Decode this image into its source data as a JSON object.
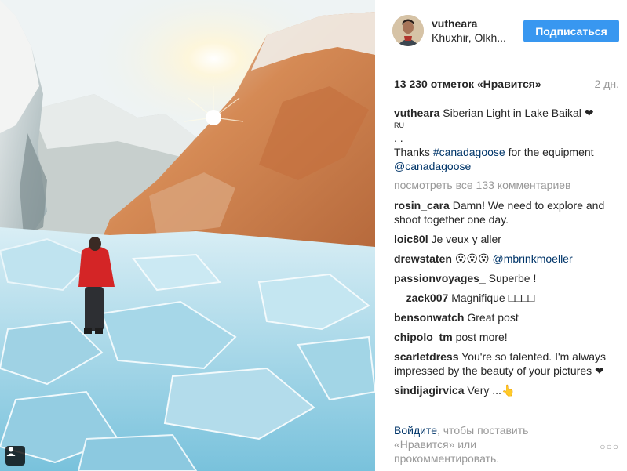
{
  "post": {
    "author": "vutheara",
    "location": "Khuxhir, Olkh...",
    "follow_label": "Подписаться",
    "likes": "13 230 отметок «Нравится»",
    "time": "2 дн."
  },
  "caption": {
    "user": "vutheara",
    "text": "Siberian Light in Lake Baikal",
    "heart": "❤",
    "lang": "RU",
    "dots": ". .",
    "thanks_prefix": "Thanks ",
    "hashtag": "#canadagoose",
    "thanks_suffix": " for the equipment ",
    "mention": "@canadagoose"
  },
  "load_more": "посмотреть все 133 комментариев",
  "comments": [
    {
      "user": "rosin_cara",
      "text": "Damn! We need to explore and shoot together one day."
    },
    {
      "user": "loic80l",
      "text": "Je veux y aller"
    },
    {
      "user": "drewstaten",
      "text": "😮😮😮 ",
      "mention": "@mbrinkmoeller"
    },
    {
      "user": "passionvoyages_",
      "text": "Superbe !"
    },
    {
      "user": "__zack007",
      "text": "Magnifique □□□□"
    },
    {
      "user": "bensonwatch",
      "text": "Great post"
    },
    {
      "user": "chipolo_tm",
      "text": "post more!"
    },
    {
      "user": "scarletdress",
      "text": "You're so talented. I'm always impressed by the beauty of your pictures ❤"
    },
    {
      "user": "sindijagirvica",
      "text": "Very ...👆"
    }
  ],
  "footer": {
    "login_link": "Войдите",
    "login_text": ", чтобы поставить «Нравится» или прокомментировать.",
    "more": "○○○"
  },
  "icons": {
    "user_tag": "person-icon",
    "more": "more-options-icon"
  },
  "colors": {
    "accent": "#3897f0",
    "link": "#003569",
    "muted": "#999999"
  }
}
